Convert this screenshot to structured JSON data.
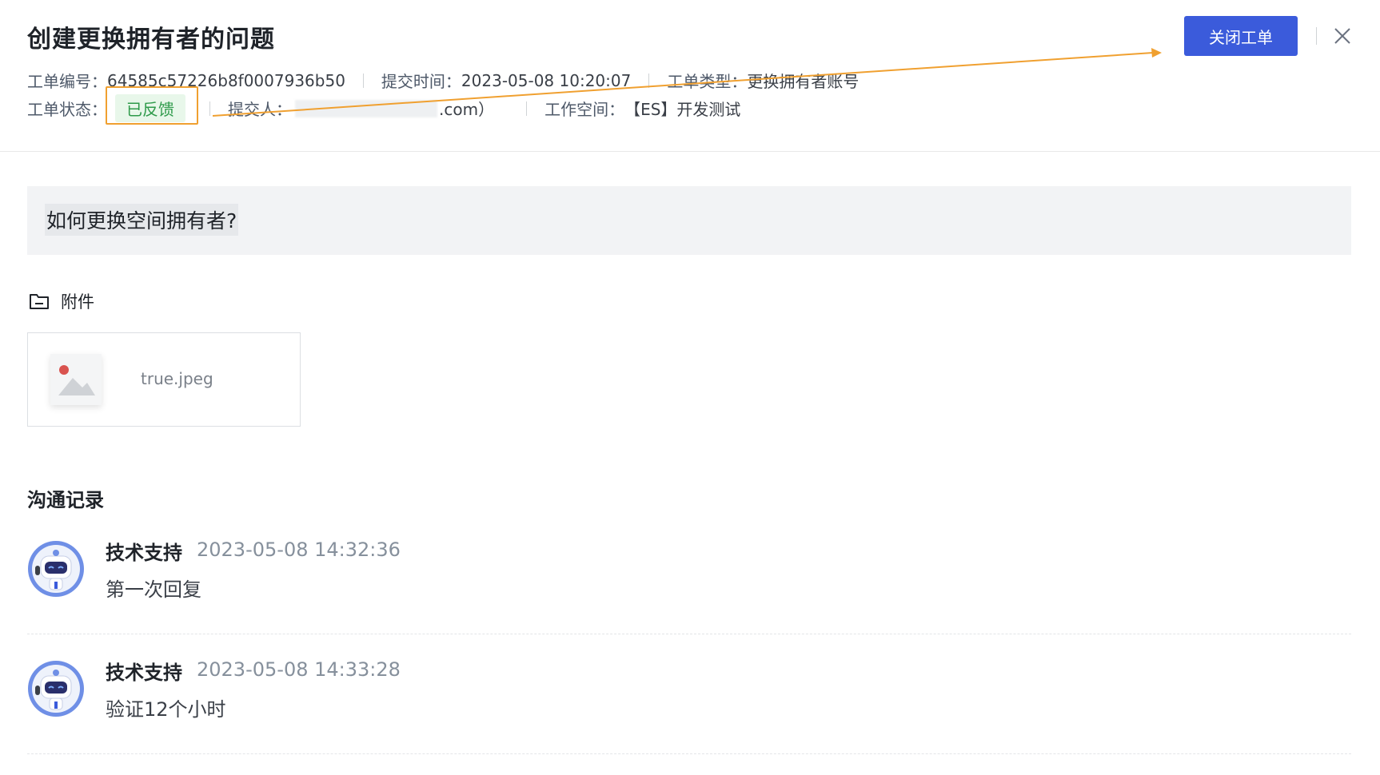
{
  "header": {
    "title": "创建更换拥有者的问题",
    "close_ticket_label": "关闭工单",
    "row1": [
      {
        "label": "工单编号：",
        "value": "64585c57226b8f0007936b50"
      },
      {
        "label": "提交时间：",
        "value": "2023-05-08 10:20:07"
      },
      {
        "label": "工单类型：",
        "value": "更换拥有者账号"
      }
    ],
    "status_label": "工单状态：",
    "status_value": "已反馈",
    "submitter_label": "提交人：",
    "submitter_suffix": ".com）",
    "workspace_label": "工作空间：",
    "workspace_value": "【ES】开发测试"
  },
  "question": "如何更换空间拥有者?",
  "attachments": {
    "label": "附件",
    "files": [
      {
        "name": "true.jpeg"
      }
    ]
  },
  "records": {
    "title": "沟通记录",
    "items": [
      {
        "author": "技术支持",
        "time": "2023-05-08 14:32:36",
        "content": "第一次回复"
      },
      {
        "author": "技术支持",
        "time": "2023-05-08 14:33:28",
        "content": "验证12个小时"
      }
    ]
  },
  "colors": {
    "primary": "#3b5bdb",
    "status_bg": "#e8f7ea",
    "status_text": "#2e9a4a",
    "annotation": "#f0a030"
  }
}
